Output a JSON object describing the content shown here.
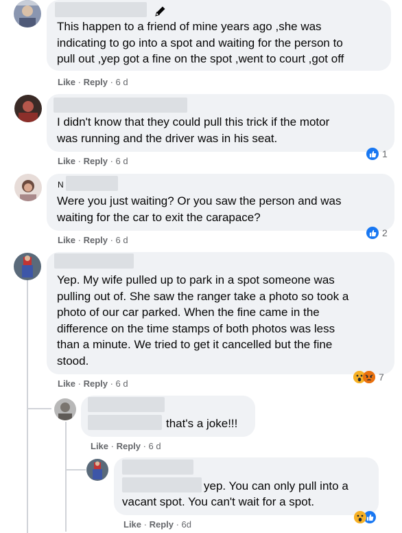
{
  "comments": [
    {
      "author_prefix": "",
      "text": "This happen to a friend of mine years ago ,she was\nindicating to go into a spot and waiting for the person to\npull out ,yep got a fine on the spot ,went to court ,got off",
      "like_label": "Like",
      "reply_label": "Reply",
      "time": "6 d",
      "reaction_count": ""
    },
    {
      "author_prefix": "",
      "text": "I didn't know that they could pull this trick if the motor\nwas running and the driver was in his seat.",
      "like_label": "Like",
      "reply_label": "Reply",
      "time": "6 d",
      "reaction_count": "1"
    },
    {
      "author_prefix": "N",
      "text": "Were you just waiting? Or you saw the person and was\nwaiting for the car to exit the carapace?",
      "like_label": "Like",
      "reply_label": "Reply",
      "time": "6 d",
      "reaction_count": "2"
    },
    {
      "author_prefix": "",
      "text": "Yep. My wife pulled up to park in a spot someone was\npulling out of. She saw the ranger take a photo so took a\nphoto of our car parked. When the fine came in the\ndifference on the time stamps of both photos was less\nthan a minute. We tried to get it cancelled but the fine\nstood.",
      "like_label": "Like",
      "reply_label": "Reply",
      "time": "6 d",
      "reaction_count": "7"
    }
  ],
  "replies": [
    {
      "text": "that's a joke!!!",
      "like_label": "Like",
      "reply_label": "Reply",
      "time": "6 d"
    },
    {
      "text_line1": "yep. You can only pull into a",
      "text_line2": "vacant spot. You can't wait for a spot.",
      "like_label": "Like",
      "reply_label": "Reply",
      "time": "6d"
    }
  ],
  "separator": " · ",
  "icons": {
    "edit": "pencil-icon",
    "like_reaction": "thumbs-up-icon",
    "wow_reaction": "wow-emoji-icon",
    "angry_reaction": "angry-emoji-icon"
  },
  "colors": {
    "bubble": "#f0f2f5",
    "like_blue": "#1877f2",
    "meta_gray": "#65676b"
  }
}
